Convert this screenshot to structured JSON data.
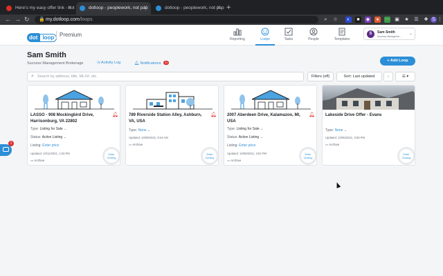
{
  "browser": {
    "tabs": [
      {
        "label": "Here's my easy offer link - dot",
        "favicon_color": "#d93025"
      },
      {
        "label": "dotloop - peoplework, not pap",
        "favicon_color": "#2c8ed6"
      },
      {
        "label": "dotloop - peoplework, not pap",
        "favicon_color": "#2c8ed6"
      }
    ],
    "new_tab": "+",
    "url_host": "my.dotloop.com",
    "url_path": "/loops",
    "nav": {
      "back": "←",
      "forward": "→",
      "reload": "↻"
    },
    "extensions": [
      "⌕",
      "☆",
      "◐",
      "■",
      "◆",
      "●",
      "⋯",
      "▣",
      "★",
      "☰",
      "✚",
      "S",
      "⋮"
    ]
  },
  "header": {
    "logo_dot": "dot",
    "logo_loop": "loop",
    "plan": "Premium",
    "nav": [
      {
        "label": "Reporting",
        "icon": "bar-chart-icon"
      },
      {
        "label": "Loops",
        "icon": "loops-icon",
        "active": true
      },
      {
        "label": "Tasks",
        "icon": "checkbox-icon"
      },
      {
        "label": "People",
        "icon": "people-icon"
      },
      {
        "label": "Templates",
        "icon": "templates-icon"
      }
    ],
    "user": {
      "initial": "S",
      "name": "Sam Smith",
      "org": "Success Manageme..."
    }
  },
  "page": {
    "title": "Sam Smith",
    "subtitle": "Success Management Brokerage",
    "activity_log": "Activity Log",
    "notifications": "Notifications",
    "notifications_count": "31",
    "add_loop": "+ Add Loop"
  },
  "toolbar": {
    "search_placeholder": "Search by address, title, MLS#, etc.",
    "filters": "Filters (off)",
    "sort": "Sort: Last updated",
    "sort_dir": "↓",
    "view": "☰ ▾"
  },
  "cards": [
    {
      "title": "LASSO - 908 Mockingbird Drive, Harrisonburg, VA 22802",
      "type_label": "Type:",
      "type": "Listing for Sale",
      "status_label": "Status:",
      "status": "Active Listing",
      "listing_label": "Listing:",
      "listing": "Enter price",
      "updated": "Updated: 10/11/2021, 1:03 PM",
      "archive": "Archive",
      "enter": "Enter Closing",
      "bell": true
    },
    {
      "title": "789 Riverside Station Alley, Ashburn, VA, USA",
      "type_label": "Type:",
      "type": "None",
      "updated": "Updated: 10/08/2021, 8:44 AM",
      "archive": "Archive",
      "enter": "Enter Closing",
      "bell": true
    },
    {
      "title": "2007 Aberdeen Drive, Kalamazoo, MI, USA",
      "type_label": "Type:",
      "type": "Listing for Sale",
      "status_label": "Status:",
      "status": "Active Listing",
      "listing_label": "Listing:",
      "listing": "Enter price",
      "updated": "Updated: 10/08/2021, 3:52 PM",
      "archive": "Archive",
      "enter": "Enter Closing",
      "bell": true
    },
    {
      "title": "Lakeside Drive Offer - Evans",
      "type_label": "Type:",
      "type": "None",
      "updated": "Updated: 10/06/2021, 3:08 PM",
      "archive": "Archive",
      "enter": "Enter Closing",
      "bell": false
    }
  ],
  "chat": {
    "badge": "1"
  },
  "colors": {
    "accent": "#2c8ed6",
    "alert": "#d9302c",
    "avatar": "#5b2a86"
  }
}
